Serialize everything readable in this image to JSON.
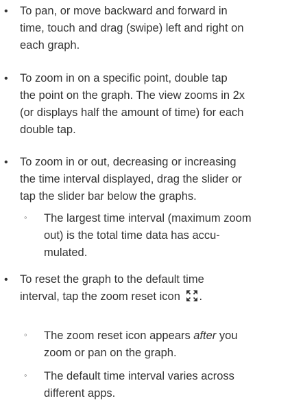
{
  "list": {
    "item1": {
      "lines": [
        "To pan, or move backward and forward in",
        "time, touch and drag (swipe) left and right on",
        "each graph."
      ]
    },
    "item2": {
      "lines": [
        "To zoom in on a specific point, double tap",
        "the point on the graph. The view zooms in 2x",
        "(or displays half the amount of time) for each",
        "double tap."
      ]
    },
    "item3": {
      "lines": [
        "To zoom in or out, decreasing or increasing",
        "the time interval displayed, drag the slider or",
        "tap the slider bar below the graphs."
      ],
      "sub1": {
        "lines": [
          "The largest time interval (maximum zoom",
          "out) is the total time data has accu-",
          "mulated."
        ]
      }
    },
    "item4": {
      "lines": [
        "To reset the graph to the default time",
        "interval, tap the zoom reset icon",
        "."
      ],
      "icon": "zoom-reset-icon",
      "sub1": {
        "line1_pre": "The zoom reset icon appears ",
        "line1_em": "after",
        "line1_post": " you",
        "line2": "zoom or pan on the graph."
      },
      "sub2": {
        "lines": [
          "The default time interval varies across",
          "different apps."
        ]
      }
    }
  },
  "markers": {
    "bullet": "•",
    "sub_bullet": "◦"
  }
}
